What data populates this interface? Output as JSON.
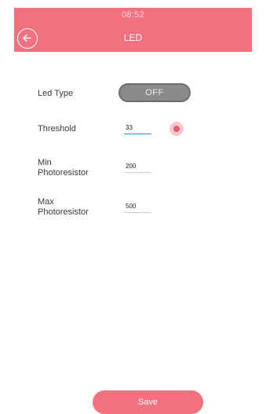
{
  "status_bar": {
    "time": "08:52"
  },
  "header": {
    "title": "LED",
    "back_icon": "arrow-left-circle-icon"
  },
  "form": {
    "led_type": {
      "label": "Led Type",
      "value": "OFF"
    },
    "threshold": {
      "label": "Threshold",
      "value": "33",
      "color_value": "#ee5b6c"
    },
    "min_photoresistor": {
      "label_line1": "Min",
      "label_line2": "Photoresistor",
      "value": "200"
    },
    "max_photoresistor": {
      "label_line1": "Max",
      "label_line2": "Photoresistor",
      "value": "500"
    }
  },
  "footer": {
    "save_label": "Save"
  },
  "colors": {
    "accent": "#f2717f",
    "toggle_off": "#8a8a8a",
    "focus_underline": "#1aa0d8"
  }
}
